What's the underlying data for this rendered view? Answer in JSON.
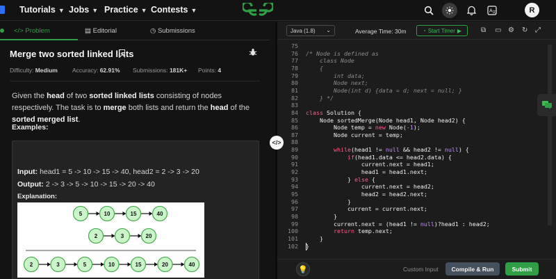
{
  "nav": {
    "items": [
      {
        "label": "Tutorials"
      },
      {
        "label": "Jobs"
      },
      {
        "label": "Practice"
      },
      {
        "label": "Contests"
      }
    ],
    "logo": "GfG",
    "avatar": "R"
  },
  "left": {
    "tabs": [
      {
        "label": "</> Problem"
      },
      {
        "label": "Editorial"
      },
      {
        "label": "Submissions"
      }
    ],
    "title": "Merge two sorted linked lists",
    "meta": {
      "difficulty_label": "Difficulty:",
      "difficulty": "Medium",
      "accuracy_label": "Accuracy:",
      "accuracy": "62.91%",
      "submissions_label": "Submissions:",
      "submissions": "181K+",
      "points_label": "Points:",
      "points": "4"
    },
    "description": {
      "p1": "Given the ",
      "b1": "head",
      "p2": " of two ",
      "b2": "sorted linked lists",
      "p3": " consisting of nodes respectively. The task is to ",
      "b3": "merge",
      "p4": " both lists and return the ",
      "b4": "head",
      "p5": " of the ",
      "b5": "sorted merged list",
      "p6": "."
    },
    "examples_label": "Examples:",
    "example": {
      "input_label": "Input:",
      "input": "head1 = 5 -> 10 -> 15 -> 40, head2 = 2 -> 3 -> 20",
      "output_label": "Output:",
      "output": "2 -> 3 -> 5 -> 10 -> 15 -> 20 -> 40",
      "explanation_label": "Explanation:",
      "list1": [
        "5",
        "10",
        "15",
        "40"
      ],
      "list2": [
        "2",
        "3",
        "20"
      ],
      "merged": [
        "2",
        "3",
        "5",
        "10",
        "15",
        "20",
        "40"
      ]
    }
  },
  "right": {
    "language": "Java (1.8)",
    "average_time": "Average Time: 30m",
    "start_timer": "Start Timer",
    "code": [
      {
        "n": "75",
        "t": ""
      },
      {
        "n": "76",
        "t": "/* Node is defined as",
        "c": "cm"
      },
      {
        "n": "77",
        "t": "    class Node",
        "c": "cm"
      },
      {
        "n": "78",
        "t": "    {",
        "c": "cm"
      },
      {
        "n": "79",
        "t": "        int data;",
        "c": "cm"
      },
      {
        "n": "80",
        "t": "        Node next;",
        "c": "cm"
      },
      {
        "n": "81",
        "t": "        Node(int d) {data = d; next = null; }",
        "c": "cm"
      },
      {
        "n": "82",
        "t": "    } */",
        "c": "cm"
      },
      {
        "n": "83",
        "t": ""
      },
      {
        "n": "84",
        "t": "class Solution {"
      },
      {
        "n": "85",
        "t": "    Node sortedMerge(Node head1, Node head2) {"
      },
      {
        "n": "86",
        "t": "        Node temp = new Node(-1);"
      },
      {
        "n": "87",
        "t": "        Node current = temp;"
      },
      {
        "n": "88",
        "t": ""
      },
      {
        "n": "89",
        "t": "        while(head1 != null && head2 != null) {"
      },
      {
        "n": "90",
        "t": "            if(head1.data <= head2.data) {"
      },
      {
        "n": "91",
        "t": "                current.next = head1;"
      },
      {
        "n": "92",
        "t": "                head1 = head1.next;"
      },
      {
        "n": "93",
        "t": "            } else {"
      },
      {
        "n": "94",
        "t": "                current.next = head2;"
      },
      {
        "n": "95",
        "t": "                head2 = head2.next;"
      },
      {
        "n": "96",
        "t": "            }"
      },
      {
        "n": "97",
        "t": "            current = current.next;"
      },
      {
        "n": "98",
        "t": "        }"
      },
      {
        "n": "99",
        "t": "        current.next = (head1 != null)?head1 : head2;"
      },
      {
        "n": "100",
        "t": "        return temp.next;"
      },
      {
        "n": "101",
        "t": "    }"
      },
      {
        "n": "102",
        "t": "}"
      }
    ],
    "custom_input": "Custom Input",
    "compile_run": "Compile & Run",
    "submit": "Submit"
  },
  "colors": {
    "accent_green": "#2f9e44",
    "keyword": "#ff5c8a",
    "comment": "#8a8a8a",
    "background": "#131313"
  },
  "icons": {
    "tag": "tag-icon",
    "search": "search-icon",
    "theme": "sun-icon",
    "notifications": "bell-icon",
    "translate": "translate-icon",
    "bookmark": "bookmark-icon",
    "bug": "bug-icon",
    "chat": "chat-icon",
    "hint": "lightbulb-icon"
  }
}
